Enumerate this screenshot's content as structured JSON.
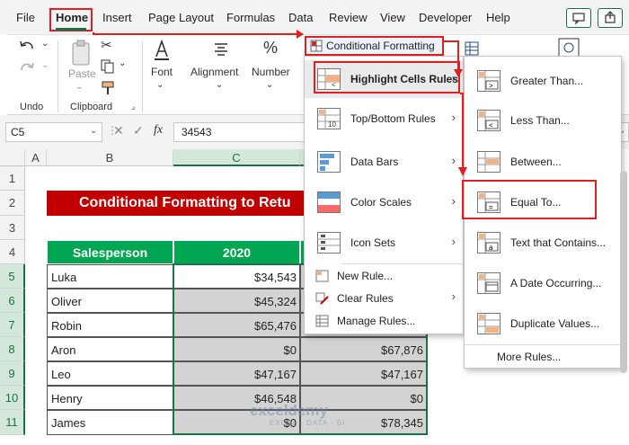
{
  "menu": {
    "tabs": [
      "File",
      "Home",
      "Insert",
      "Page Layout",
      "Formulas",
      "Data",
      "Review",
      "View",
      "Developer",
      "Help"
    ],
    "active_tab": "Home"
  },
  "ribbon": {
    "groups": {
      "undo": "Undo",
      "clipboard": "Clipboard",
      "font": "Font",
      "alignment": "Alignment",
      "number": "Number"
    },
    "paste_label": "Paste"
  },
  "formula_bar": {
    "name_box": "C5",
    "fx_label": "fx",
    "value": "34543"
  },
  "columns": [
    "A",
    "B",
    "C"
  ],
  "rows": [
    "1",
    "2",
    "3",
    "4",
    "5",
    "6",
    "7",
    "8",
    "9",
    "10",
    "11"
  ],
  "sheet": {
    "title": "Conditional Formatting to Retu",
    "headers": [
      "Salesperson",
      "2020"
    ],
    "data": [
      {
        "name": "Luka",
        "v2020": "$34,543",
        "v2021": ""
      },
      {
        "name": "Oliver",
        "v2020": "$45,324",
        "v2021": ""
      },
      {
        "name": "Robin",
        "v2020": "$65,476",
        "v2021": ""
      },
      {
        "name": "Aron",
        "v2020": "$0",
        "v2021": "$67,876"
      },
      {
        "name": "Leo",
        "v2020": "$47,167",
        "v2021": "$47,167"
      },
      {
        "name": "Henry",
        "v2020": "$46,548",
        "v2021": "$0"
      },
      {
        "name": "James",
        "v2020": "$0",
        "v2021": "$78,345"
      }
    ]
  },
  "conditional_formatting": {
    "button_label": "Conditional Formatting",
    "items": [
      {
        "label": "Highlight Cells Rules"
      },
      {
        "label": "Top/Bottom Rules"
      },
      {
        "label": "Data Bars"
      },
      {
        "label": "Color Scales"
      },
      {
        "label": "Icon Sets"
      }
    ],
    "small_items": [
      {
        "label": "New Rule..."
      },
      {
        "label": "Clear Rules"
      },
      {
        "label": "Manage Rules..."
      }
    ]
  },
  "highlight_submenu": {
    "items": [
      {
        "label": "Greater Than..."
      },
      {
        "label": "Less Than..."
      },
      {
        "label": "Between..."
      },
      {
        "label": "Equal To..."
      },
      {
        "label": "Text that Contains..."
      },
      {
        "label": "A Date Occurring..."
      },
      {
        "label": "Duplicate Values..."
      }
    ],
    "more": "More Rules..."
  },
  "watermark": {
    "name": "exceldemy",
    "tagline": "EXCEL · DATA · BI"
  },
  "colors": {
    "excel_green": "#1e7145",
    "header_green": "#00a651",
    "title_red": "#c00000",
    "callout_red": "#e02020"
  }
}
